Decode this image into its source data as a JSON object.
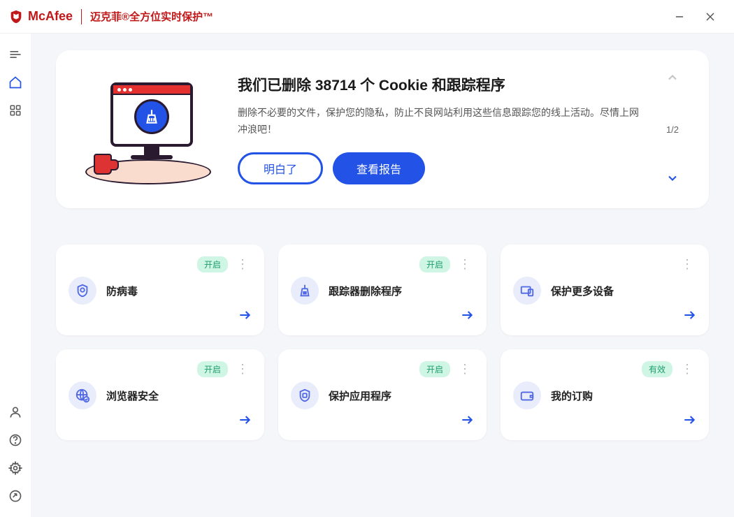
{
  "header": {
    "brand": "McAfee",
    "subtitle": "迈克菲®全方位实时保护™"
  },
  "hero": {
    "title": "我们已删除 38714 个 Cookie 和跟踪程序",
    "description": "删除不必要的文件，保护您的隐私，防止不良网站利用这些信息跟踪您的线上活动。尽情上网冲浪吧！",
    "button_ok": "明白了",
    "button_report": "查看报告",
    "pager": "1/2"
  },
  "cards": [
    {
      "title": "防病毒",
      "badge": "开启",
      "icon": "shield"
    },
    {
      "title": "跟踪器删除程序",
      "badge": "开启",
      "icon": "broom"
    },
    {
      "title": "保护更多设备",
      "badge": null,
      "icon": "devices"
    },
    {
      "title": "浏览器安全",
      "badge": "开启",
      "icon": "globe"
    },
    {
      "title": "保护应用程序",
      "badge": "开启",
      "icon": "app-shield"
    },
    {
      "title": "我的订购",
      "badge": "有效",
      "icon": "wallet"
    }
  ]
}
